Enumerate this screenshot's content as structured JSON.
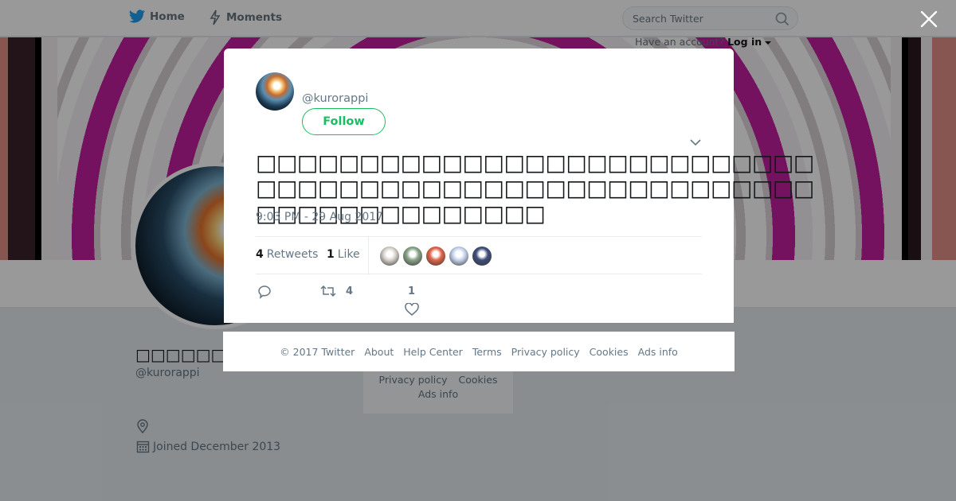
{
  "nav": {
    "home_label": "Home",
    "moments_label": "Moments"
  },
  "search": {
    "placeholder": "Search Twitter"
  },
  "login": {
    "prompt": "Have an account?",
    "link": "Log in"
  },
  "profile": {
    "name": "□□□□□□",
    "handle": "@kurorappi",
    "joined": "Joined December 2013"
  },
  "background_footer": {
    "row1": [
      "Privacy policy",
      "Cookies"
    ],
    "row2": [
      "Ads info"
    ]
  },
  "tweet": {
    "handle": "@kurorappi",
    "follow_label": "Follow",
    "text": "□□□□□□□□□□□□□□□□□□□□□□□□□□□□□□□□□□□□□□□□□□□□□□□□□□□□□□□□□□□□□□□□□□□□",
    "timestamp": "9:03 PM - 29 Aug 2017",
    "stats": {
      "retweets_count": "4",
      "retweets_label": "Retweets",
      "likes_count": "1",
      "likes_label": "Like"
    },
    "actions": {
      "retweet_count": "4",
      "like_count": "1"
    },
    "liker_avatar_colors": [
      "#d9d4cc",
      "#8aa58a",
      "#e0664a",
      "#c9d6ef",
      "#3f4f7a"
    ]
  },
  "modal_footer": {
    "copyright": "© 2017 Twitter",
    "links": [
      "About",
      "Help Center",
      "Terms",
      "Privacy policy",
      "Cookies",
      "Ads info"
    ]
  },
  "colors": {
    "twitter_blue": "#1da1f2",
    "follow_green": "#17bf63",
    "muted_text": "#657786"
  }
}
